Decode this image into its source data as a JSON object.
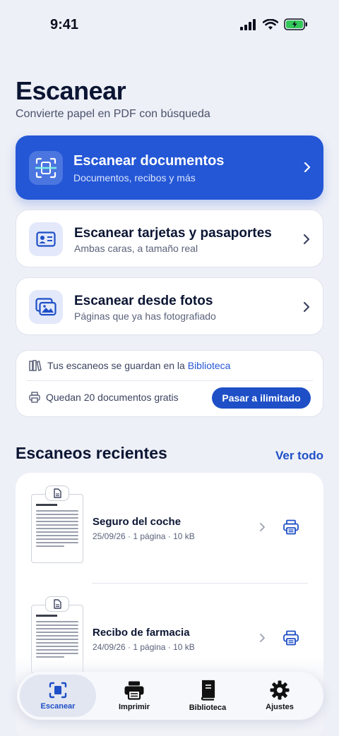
{
  "status_bar": {
    "time": "9:41"
  },
  "header": {
    "title": "Escanear",
    "subtitle": "Convierte papel en PDF con búsqueda"
  },
  "actions": [
    {
      "title": "Escanear documentos",
      "subtitle": "Documentos, recibos y más",
      "icon": "scan-document-icon"
    },
    {
      "title": "Escanear tarjetas y pasaportes",
      "subtitle": "Ambas caras, a tamaño real",
      "icon": "id-card-icon"
    },
    {
      "title": "Escanear desde fotos",
      "subtitle": "Páginas que ya has fotografiado",
      "icon": "photos-icon"
    }
  ],
  "info": {
    "library_text": "Tus escaneos se guardan en la",
    "library_link": "Biblioteca",
    "free_text": "Quedan 20 documentos gratis",
    "upgrade_label": "Pasar a ilimitado"
  },
  "recent": {
    "title": "Escaneos recientes",
    "see_all": "Ver todo",
    "items": [
      {
        "name": "Seguro del coche",
        "meta": "25/09/26 · 1 página · 10 kB"
      },
      {
        "name": "Recibo de farmacia",
        "meta": "24/09/26 · 1 página · 10 kB"
      }
    ]
  },
  "tabs": [
    {
      "label": "Escanear",
      "icon": "scan-icon",
      "active": true
    },
    {
      "label": "Imprimir",
      "icon": "printer-icon",
      "active": false
    },
    {
      "label": "Biblioteca",
      "icon": "book-icon",
      "active": false
    },
    {
      "label": "Ajustes",
      "icon": "gear-icon",
      "active": false
    }
  ],
  "colors": {
    "accent": "#2457d6",
    "background": "#eef0f7",
    "text": "#0b1533"
  }
}
